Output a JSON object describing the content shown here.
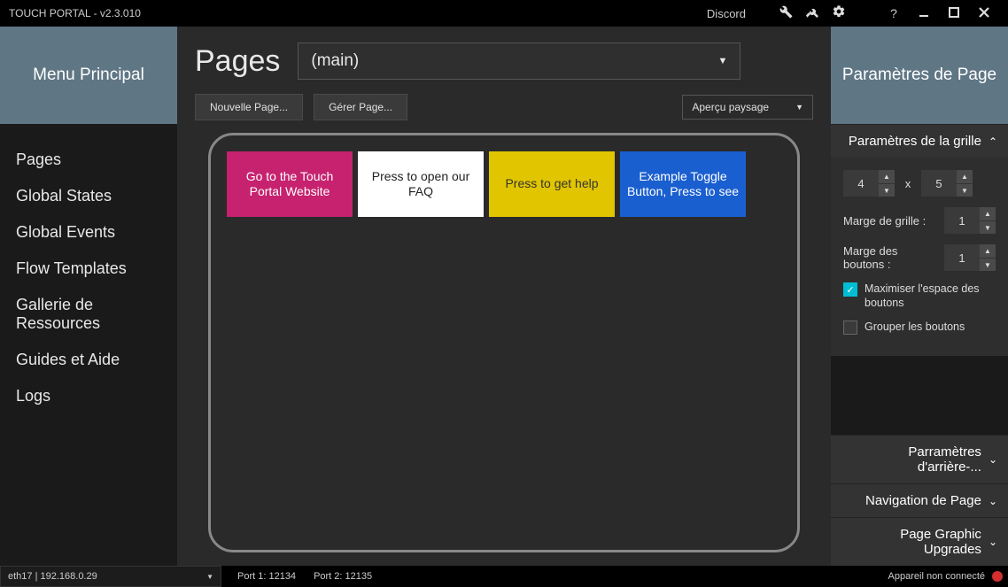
{
  "titlebar": {
    "title": "TOUCH PORTAL - v2.3.010",
    "discord": "Discord"
  },
  "sidebar": {
    "header": "Menu Principal",
    "items": [
      "Pages",
      "Global States",
      "Global Events",
      "Flow Templates",
      "Gallerie de Ressources",
      "Guides et Aide",
      "Logs"
    ]
  },
  "center": {
    "title": "Pages",
    "page_selected": "(main)",
    "new_page": "Nouvelle Page...",
    "manage_page": "Gérer Page...",
    "preview_mode": "Aperçu paysage",
    "buttons": [
      {
        "label": "Go to the Touch Portal Website",
        "cls": "b-pink"
      },
      {
        "label": "Press to open our FAQ",
        "cls": "b-white"
      },
      {
        "label": "Press to get help",
        "cls": "b-yellow"
      },
      {
        "label": "Example Toggle Button, Press to see",
        "cls": "b-blue"
      }
    ]
  },
  "right": {
    "header": "Paramètres de Page",
    "grid": {
      "title": "Paramètres de la grille",
      "cols": "4",
      "rows": "5",
      "x": "x",
      "grid_margin_label": "Marge de grille :",
      "grid_margin": "1",
      "button_margin_label": "Marge des boutons :",
      "button_margin": "1",
      "maximize": "Maximiser l'espace des boutons",
      "group": "Grouper les boutons"
    },
    "sections": [
      "Parramètres d'arrière-...",
      "Navigation de Page",
      "Page Graphic Upgrades"
    ]
  },
  "status": {
    "net": "eth17 | 192.168.0.29",
    "port1": "Port 1: 12134",
    "port2": "Port 2: 12135",
    "conn": "Appareil non connecté"
  }
}
